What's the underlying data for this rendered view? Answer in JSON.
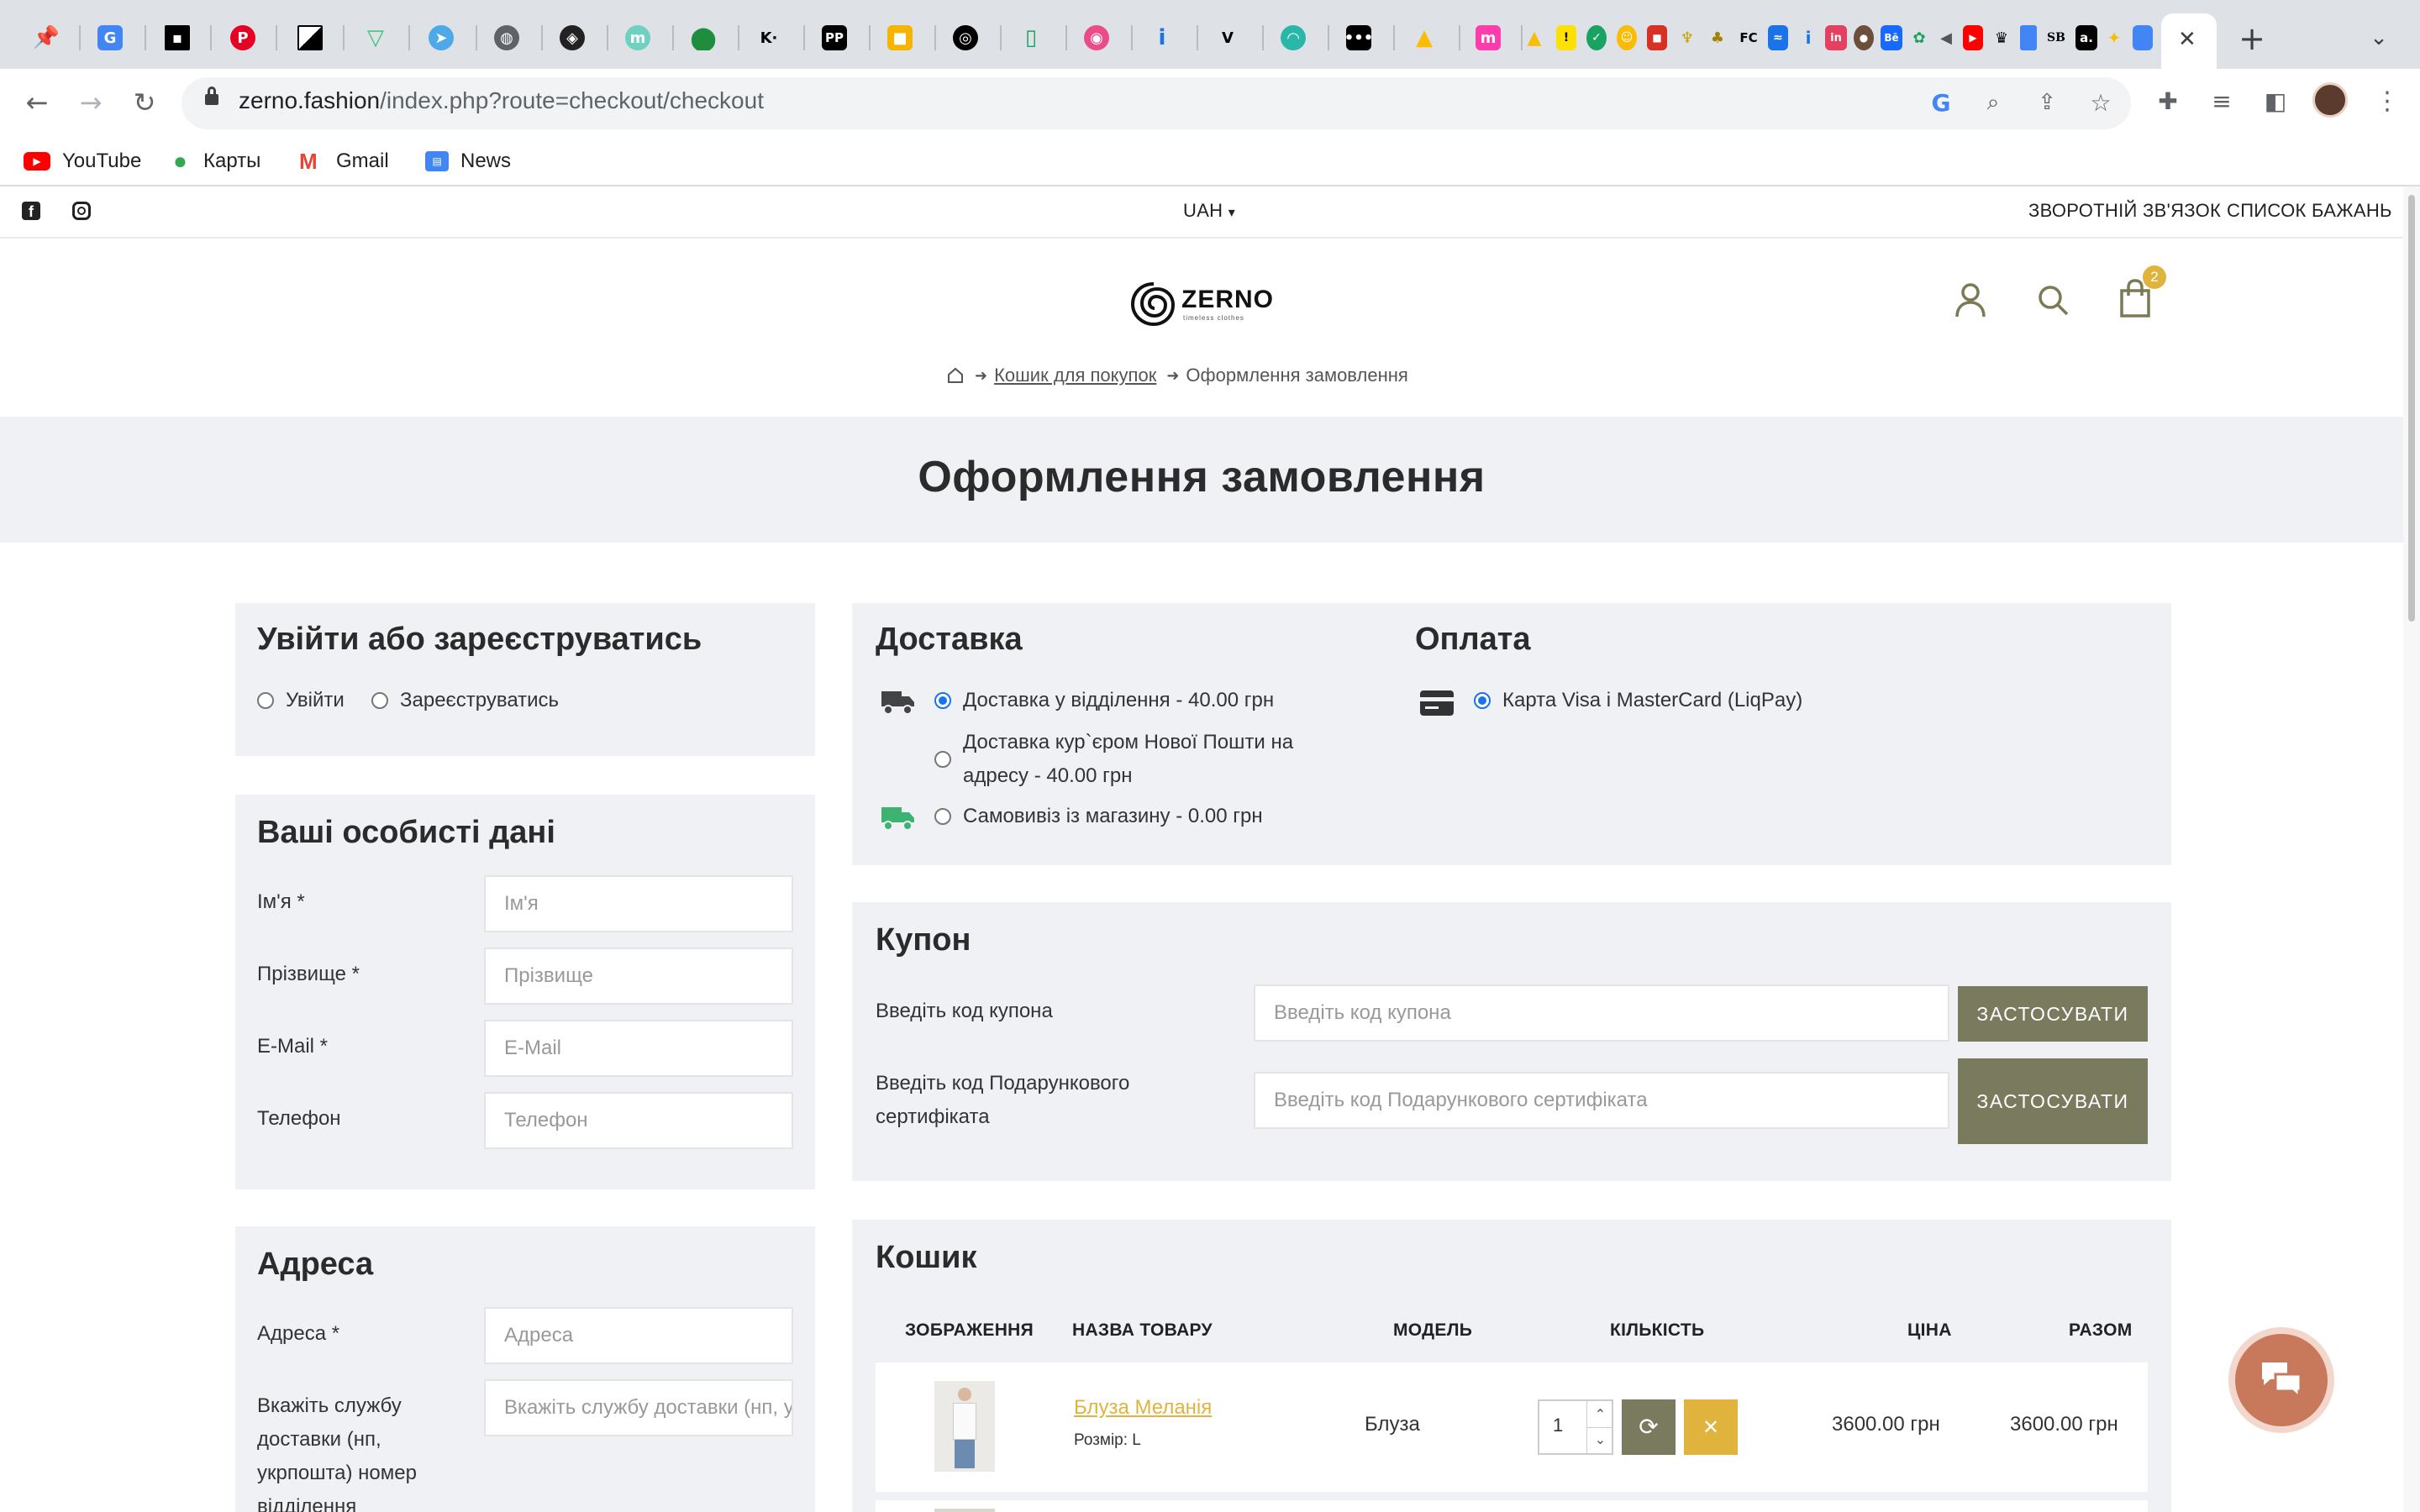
{
  "browser": {
    "url_domain": "zerno.fashion",
    "url_path": "/index.php?route=checkout/checkout",
    "bookmarks": [
      "YouTube",
      "Карты",
      "Gmail",
      "News"
    ],
    "tab_glyphs": [
      "PP",
      "FC",
      "SB",
      "a."
    ],
    "new_tab": "+",
    "close_tab": "✕"
  },
  "site": {
    "currency": "UAH",
    "feedback_link": "ЗВОРОТНІЙ ЗВ'ЯЗОК",
    "wishlist_link": "СПИСОК БАЖАНЬ",
    "logo_text": "ZERNO",
    "logo_tagline": "timeless clothes",
    "cart_count": "2",
    "breadcrumb": [
      "Кошик для покупок",
      "Оформлення замовлення"
    ],
    "page_title": "Оформлення замовлення"
  },
  "login_panel": {
    "title": "Увійти або зареєструватись",
    "options": [
      "Увійти",
      "Зареєструватись"
    ]
  },
  "personal": {
    "title": "Ваші особисті дані",
    "fields": [
      {
        "label": "Ім'я *",
        "placeholder": "Ім'я"
      },
      {
        "label": "Прізвище *",
        "placeholder": "Прізвище"
      },
      {
        "label": "E-Mail *",
        "placeholder": "E-Mail"
      },
      {
        "label": "Телефон",
        "placeholder": "Телефон"
      }
    ]
  },
  "address": {
    "title": "Адреса",
    "address_label": "Адреса *",
    "address_placeholder": "Адреса",
    "service_label_lines": [
      "Вкажіть службу",
      "доставки (нп,",
      "укрпошта) номер",
      "відділення"
    ],
    "service_placeholder": "Вкажіть службу доставки (нп, укрпошта) номер відділення"
  },
  "delivery": {
    "title": "Доставка",
    "options": [
      {
        "line1": "Доставка у відділення - 40.00 грн",
        "line2": "",
        "selected": true
      },
      {
        "line1": "Доставка кур`єром Нової Пошти на",
        "line2": "адресу - 40.00 грн",
        "selected": false
      },
      {
        "line1": "Самовивіз із магазину - 0.00 грн",
        "line2": "",
        "selected": false
      }
    ]
  },
  "payment": {
    "title": "Оплата",
    "option": "Карта Visa і MasterCard (LiqPay)",
    "selected": true
  },
  "coupon": {
    "title": "Купон",
    "coupon_label": "Введіть код купона",
    "coupon_placeholder": "Введіть код купона",
    "apply_label": "ЗАСТОСУВАТИ",
    "gift_label_lines": [
      "Введіть код Подарункового",
      "сертифіката"
    ],
    "gift_placeholder": "Введіть код Подарункового сертифіката"
  },
  "cart": {
    "title": "Кошик",
    "headers": [
      "ЗОБРАЖЕННЯ",
      "НАЗВА ТОВАРУ",
      "МОДЕЛЬ",
      "КІЛЬКІСТЬ",
      "ЦІНА",
      "РАЗОМ"
    ],
    "items": [
      {
        "name": "Блуза Меланія",
        "option": "Розмір: L",
        "model": "Блуза",
        "qty": "1",
        "price": "3600.00 грн",
        "total": "3600.00 грн"
      }
    ]
  },
  "colors": {
    "accent": "#7a7b5e",
    "gold": "#e0b43c",
    "panel": "#f0f1f5",
    "chat": "#c8795c"
  }
}
